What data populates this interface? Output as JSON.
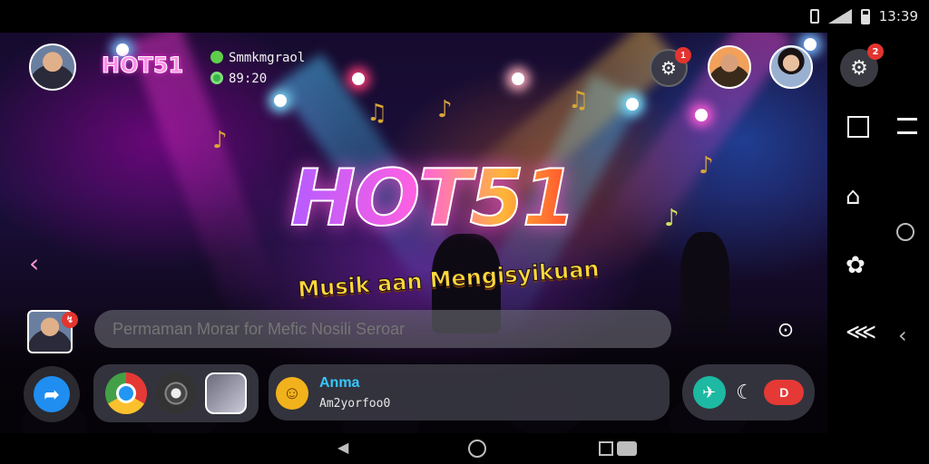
{
  "status_bar": {
    "time": "13:39"
  },
  "header": {
    "app_logo": "HOT51",
    "chat_preview": "Smmkmgraol",
    "timer": "89:20",
    "hub_badge": "1",
    "settings_badge": "2"
  },
  "hero": {
    "title": "HOT51",
    "subtitle": "Musik aan Mengisyikuan"
  },
  "message_bar": {
    "placeholder": "Permaman Morar for Mefic Nosili Seroar"
  },
  "chat_card": {
    "name": "Anma",
    "text": "Am2yorfoo0"
  },
  "social": {
    "live_label": "D"
  },
  "icons": {
    "stage": [
      "music-note-icon",
      "back-arrow-icon",
      "hub-icon",
      "gift-icon"
    ],
    "dock": [
      "share-arrow-icon",
      "chrome-icon",
      "vinyl-icon",
      "photo-icon",
      "chat-bubble-icon",
      "twitter-icon",
      "call-icon",
      "live-icon"
    ],
    "side_panel": [
      "settings-icon",
      "square-icon",
      "tab-icon",
      "home-icon",
      "circle-icon",
      "puzzle-icon",
      "share-icon",
      "collapse-icon"
    ]
  },
  "colors": {
    "accent_pink": "#ff60e0",
    "accent_yellow": "#ffd93a",
    "chat_name": "#36c8ff",
    "badge_red": "#e3342f"
  }
}
